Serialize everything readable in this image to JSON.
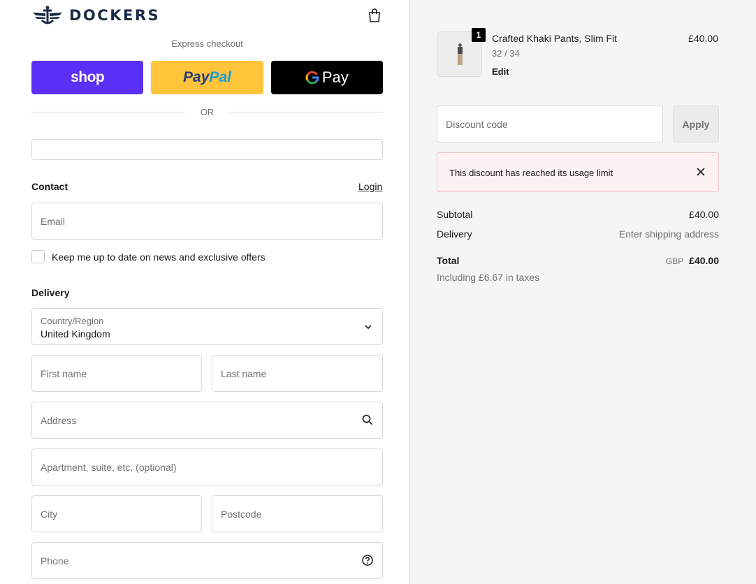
{
  "brand": {
    "name": "DOCKERS",
    "logo_icon": "anchor-wings-icon"
  },
  "header": {
    "bag_icon": "shopping-bag-icon"
  },
  "express": {
    "label": "Express checkout",
    "buttons": {
      "shop": "shop",
      "paypal_a": "Pay",
      "paypal_b": "Pal",
      "gpay": "Pay"
    }
  },
  "divider": {
    "or_label": "OR"
  },
  "contact": {
    "title": "Contact",
    "login_label": "Login",
    "email_placeholder": "Email",
    "newsletter_label": "Keep me up to date on news and exclusive offers"
  },
  "delivery": {
    "title": "Delivery",
    "country_label": "Country/Region",
    "country_value": "United Kingdom",
    "first_name_placeholder": "First name",
    "last_name_placeholder": "Last name",
    "address_placeholder": "Address",
    "apartment_placeholder": "Apartment, suite, etc. (optional)",
    "city_placeholder": "City",
    "postcode_placeholder": "Postcode",
    "phone_placeholder": "Phone"
  },
  "cart": {
    "item": {
      "quantity": "1",
      "name": "Crafted Khaki Pants, Slim Fit",
      "variant": "32 / 34",
      "edit_label": "Edit",
      "price": "£40.00"
    },
    "discount": {
      "placeholder": "Discount code",
      "apply_label": "Apply",
      "error_message": "This discount has reached its usage limit"
    },
    "summary": {
      "subtotal_label": "Subtotal",
      "subtotal_value": "£40.00",
      "delivery_label": "Delivery",
      "delivery_value": "Enter shipping address",
      "total_label": "Total",
      "total_currency": "GBP",
      "total_value": "£40.00",
      "tax_note": "Including £6.67 in taxes"
    }
  },
  "colors": {
    "shop_pay": "#5a31f4",
    "paypal": "#ffc439",
    "gpay": "#000000",
    "brand_navy": "#1d2a44",
    "error_bg": "#fdf1f1"
  }
}
